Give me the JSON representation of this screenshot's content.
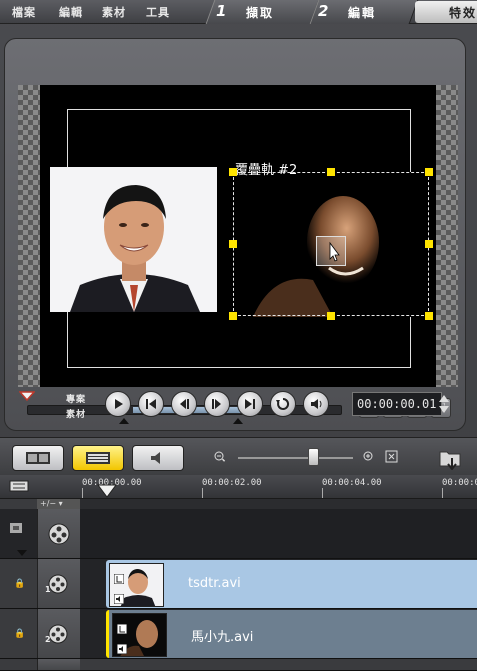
{
  "menu": {
    "items": [
      "檔案",
      "編輯",
      "素材",
      "工具"
    ]
  },
  "steps": [
    {
      "num": "1",
      "label": "擷取"
    },
    {
      "num": "2",
      "label": "編輯"
    },
    {
      "label": "特效"
    }
  ],
  "preview": {
    "overlay_label": "覆疊軌 #2"
  },
  "transport": {
    "project_label": "專案",
    "clip_label": "素材",
    "timecode": "00:00:00.01"
  },
  "timeline": {
    "ticks": [
      "00:00:00.00",
      "00:00:02.00",
      "00:00:04.00",
      "00:00:0"
    ],
    "header_controls": "+/− ▾",
    "tracks": [
      {
        "num": "1",
        "clip_name": "tsdtr.avi"
      },
      {
        "num": "2",
        "clip_name": "馬小九.avi"
      }
    ]
  },
  "colors": {
    "accent_yellow": "#ffe400",
    "clip1_bg": "#a9c7e4",
    "clip2_bg": "#6d7f90"
  }
}
